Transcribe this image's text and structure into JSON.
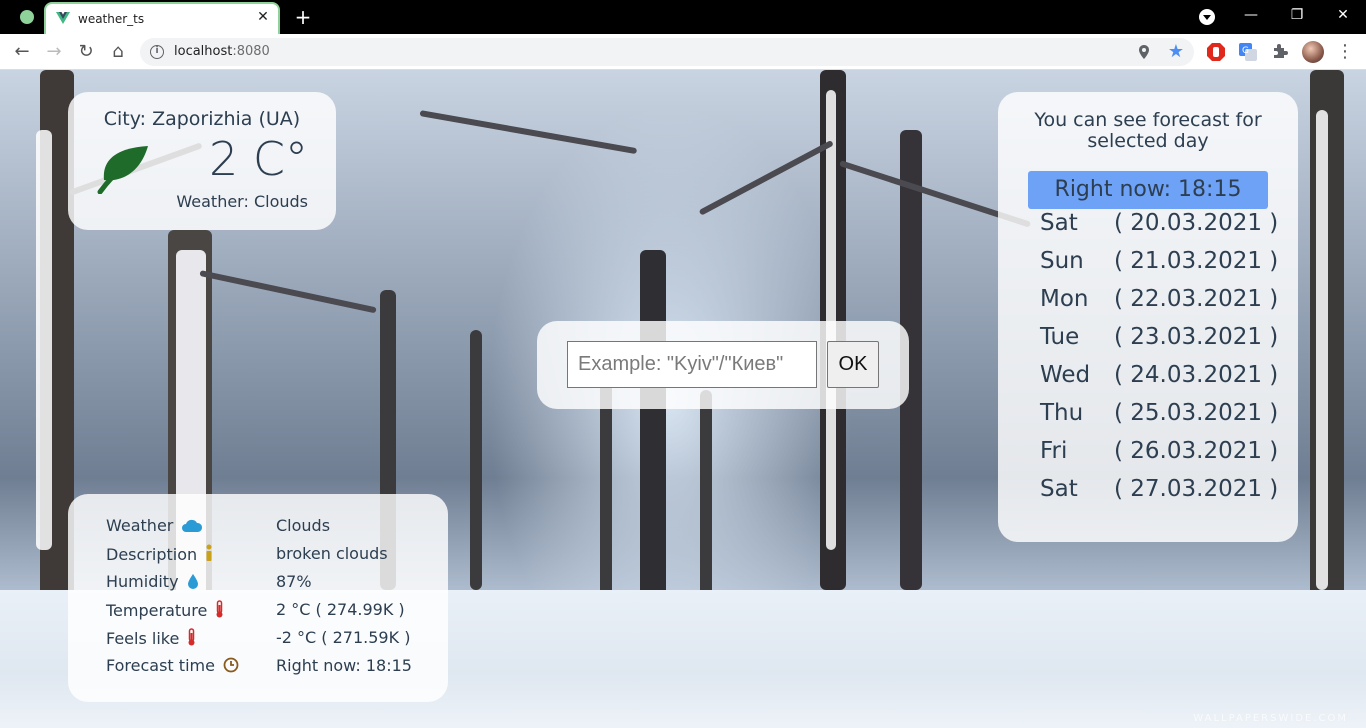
{
  "browser": {
    "tab_title": "weather_ts",
    "url_host": "localhost",
    "url_port": ":8080"
  },
  "city_card": {
    "title": "City: Zaporizhia (UA)",
    "temperature": "2 C°",
    "weather": "Weather: Clouds",
    "icon": "leaf-icon",
    "accent": "#1e6b2a"
  },
  "search": {
    "placeholder": "Example: \"Kyiv\"/\"Киев\"",
    "button_label": "OK"
  },
  "details": {
    "rows": [
      {
        "label": "Weather",
        "value": "Clouds",
        "icon": "cloud-icon"
      },
      {
        "label": "Description",
        "value": "broken clouds",
        "icon": "info-icon"
      },
      {
        "label": "Humidity",
        "value": "87%",
        "icon": "droplet-icon"
      },
      {
        "label": "Temperature",
        "value": "2 °C ( 274.99K )",
        "icon": "thermometer-icon"
      },
      {
        "label": "Feels like",
        "value": "-2 °C ( 271.59K )",
        "icon": "thermometer-icon"
      },
      {
        "label": "Forecast time",
        "value": "Right now: 18:15",
        "icon": "clock-icon"
      }
    ]
  },
  "forecast": {
    "title_line1": "You can see forecast for",
    "title_line2": "selected day",
    "now_label": "Right now: 18:15",
    "accent": "#6ea2f7",
    "days": [
      {
        "day": "Sat",
        "date": "( 20.03.2021 )"
      },
      {
        "day": "Sun",
        "date": "( 21.03.2021 )"
      },
      {
        "day": "Mon",
        "date": "( 22.03.2021 )"
      },
      {
        "day": "Tue",
        "date": "( 23.03.2021 )"
      },
      {
        "day": "Wed",
        "date": "( 24.03.2021 )"
      },
      {
        "day": "Thu",
        "date": "( 25.03.2021 )"
      },
      {
        "day": "Fri",
        "date": "( 26.03.2021 )"
      },
      {
        "day": "Sat",
        "date": "( 27.03.2021 )"
      }
    ]
  }
}
